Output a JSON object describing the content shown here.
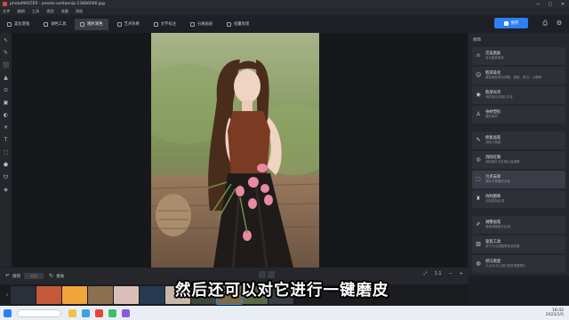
{
  "window": {
    "title": "photoMASTER - pexels-xoldaenip-13866006.jpg",
    "min": "—",
    "max": "▢",
    "close": "✕"
  },
  "menu": [
    "文件",
    "编辑",
    "工具",
    "视图",
    "收藏",
    "帮助"
  ],
  "toolbar": {
    "tabs": [
      {
        "label": "美化增强",
        "active": false
      },
      {
        "label": "调色工具",
        "active": false
      },
      {
        "label": "图片润色",
        "active": true
      },
      {
        "label": "艺术效果",
        "active": false
      },
      {
        "label": "文字标注",
        "active": false
      },
      {
        "label": "分离画层",
        "active": false
      },
      {
        "label": "批量处理",
        "active": false
      }
    ],
    "save_label": "保存",
    "print_icon": "printer-icon",
    "settings_icon": "gear-icon"
  },
  "left_tools": [
    "↖",
    "✎",
    "⬛",
    "▲",
    "⊙",
    "▣",
    "◐",
    "☀",
    "T",
    "⬚",
    "⬟",
    "ᗢ",
    "◈"
  ],
  "right_panel": {
    "title": "修饰",
    "items": [
      {
        "title": "完美肌肤",
        "desc": "自动肌肤美化",
        "icon": "∩"
      },
      {
        "title": "脸部美化",
        "desc": "瘦脸瘦脸美化调整、瘦脸、美白、小眼睛",
        "icon": "☺"
      },
      {
        "title": "脸部光泽",
        "desc": "消除高光/阴影/去油",
        "icon": "◉"
      },
      {
        "title": "身材塑形",
        "desc": "塑形身材",
        "icon": "♙"
      },
      {
        "title": "修复画笔",
        "desc": "消除小瑕疵",
        "icon": "✎",
        "gap": true
      },
      {
        "title": "消除红眼",
        "desc": "消除照片中红眼以及猫眼",
        "icon": "◎"
      },
      {
        "title": "污点去除",
        "desc": "擦除不需要的对象",
        "icon": "⬚",
        "selected": true
      },
      {
        "title": "仿制图章",
        "desc": "仿制复制区域",
        "icon": "♜"
      },
      {
        "title": "调整画笔",
        "desc": "局部调整照片区域",
        "icon": "✐",
        "gap": true
      },
      {
        "title": "渐变工具",
        "desc": "用于天空调整等渐变效果",
        "icon": "▥"
      },
      {
        "title": "径向渐变",
        "desc": "以点为中心进行渐变调整照片",
        "icon": "◍"
      }
    ]
  },
  "bottom_bar": {
    "undo_label": "撤销",
    "compare_label": "对比",
    "redo_label": "重做",
    "zoom_label": "1:1",
    "fit_icon": "fit-screen-icon",
    "zoom_out": "−",
    "zoom_in": "+"
  },
  "subtitle": "然后还可以对它进行一键磨皮",
  "taskbar": {
    "time": "18:42",
    "date": "2023/1/5"
  }
}
